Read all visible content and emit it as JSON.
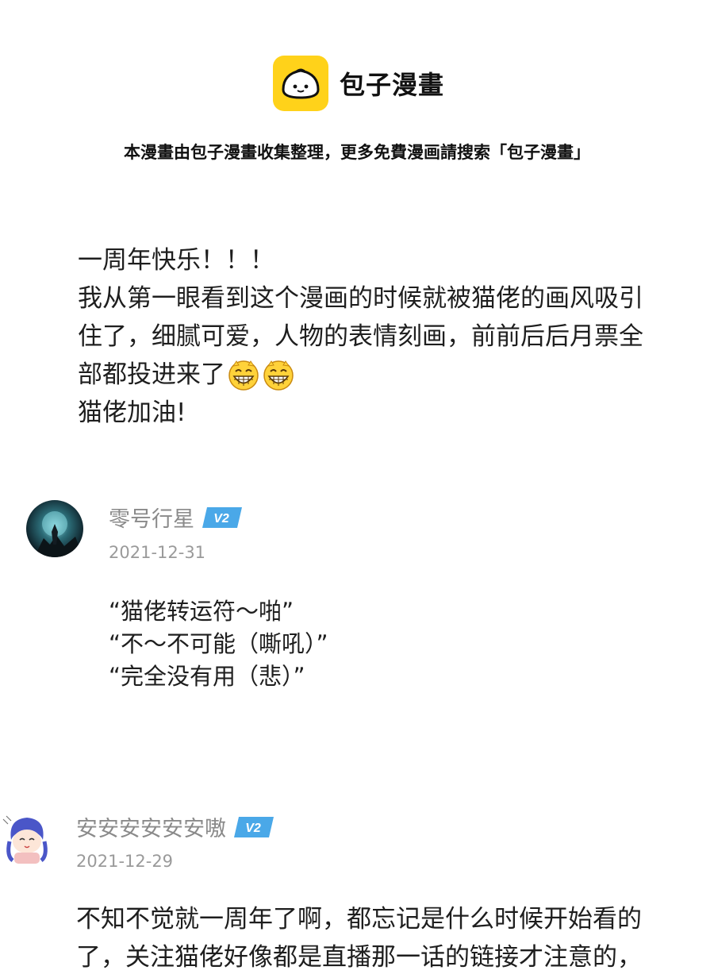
{
  "header": {
    "brand_name": "包子漫畫",
    "notice": "本漫畫由包子漫畫收集整理，更多免費漫画請搜索「包子漫畫」"
  },
  "post": {
    "lines": [
      "一周年快乐！！！",
      "我从第一眼看到这个漫画的时候就被猫佬的画风吸引",
      "住了，细腻可爱，人物的表情刻画，前前后后月票全",
      "部都投进来了",
      "猫佬加油!"
    ],
    "emoji_icon": "grinning-face-icon"
  },
  "comments": [
    {
      "username": "零号行星",
      "badge": "V2",
      "date": "2021-12-31",
      "lines": [
        "“猫佬转运符～啪”",
        "“不～不可能（嘶吼）”",
        "“完全没有用（悲）”"
      ]
    },
    {
      "username": "安安安安安安嗷",
      "badge": "V2",
      "date": "2021-12-29",
      "lines": [
        "不知不觉就一周年了啊，都忘记是什么时候开始看的",
        "了，关注猫佬好像都是直播那一话的链接才注意的，"
      ]
    }
  ],
  "colors": {
    "logo": "#ffd21a",
    "badge": "#4aa8e8",
    "username": "#8a8a8a",
    "date": "#9a9a9a"
  }
}
